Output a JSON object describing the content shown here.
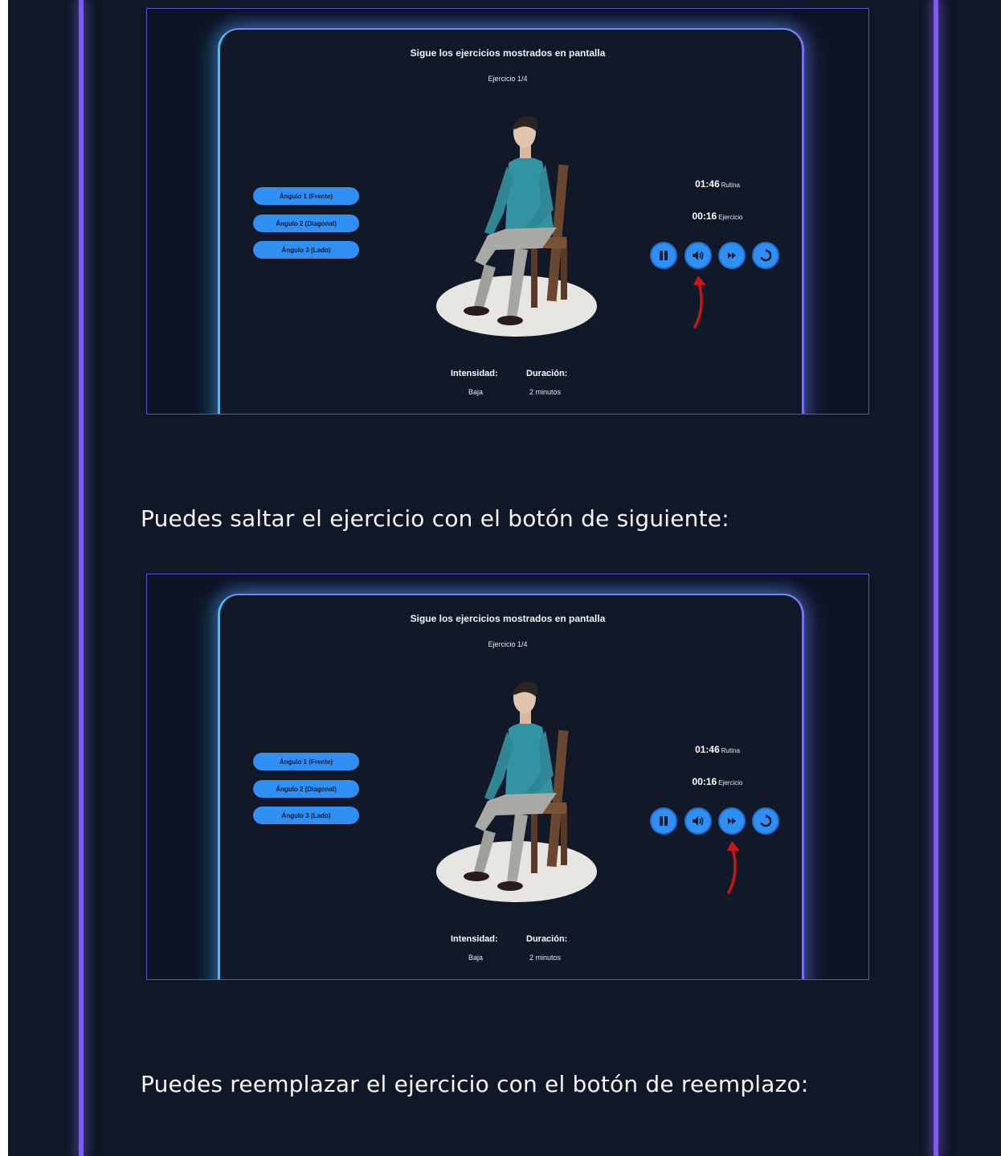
{
  "sections": [
    {
      "title": "Sigue los ejercicios mostrados en pantalla",
      "subtitle": "Ejercicio 1/4",
      "angles": [
        "Ángulo 1 (Frente)",
        "Ángulo 2 (Diagonal)",
        "Ángulo 3 (Lado)"
      ],
      "timers": {
        "routine_time": "01:46",
        "routine_label": "Rutina",
        "exercise_time": "00:16",
        "exercise_label": "Ejercicio"
      },
      "controls": [
        "pause-icon",
        "volume-icon",
        "next-icon",
        "replace-icon"
      ],
      "highlighted_control": "volume-icon",
      "stats": {
        "intensity_label": "Intensidad:",
        "intensity_value": "Baja",
        "duration_label": "Duración:",
        "duration_value": "2 minutos"
      }
    },
    {
      "title": "Sigue los ejercicios mostrados en pantalla",
      "subtitle": "Ejercicio 1/4",
      "angles": [
        "Ángulo 1 (Frente)",
        "Ángulo 2 (Diagonal)",
        "Ángulo 3 (Lado)"
      ],
      "timers": {
        "routine_time": "01:46",
        "routine_label": "Rutina",
        "exercise_time": "00:16",
        "exercise_label": "Ejercicio"
      },
      "controls": [
        "pause-icon",
        "volume-icon",
        "next-icon",
        "replace-icon"
      ],
      "highlighted_control": "next-icon",
      "stats": {
        "intensity_label": "Intensidad:",
        "intensity_value": "Baja",
        "duration_label": "Duración:",
        "duration_value": "2 minutos"
      }
    }
  ],
  "captions": [
    "Puedes saltar el ejercicio con el botón de siguiente:",
    "Puedes reemplazar el ejercicio con el botón de reemplazo:"
  ],
  "colors": {
    "page_bg": "#101726",
    "accent_blue": "#2f8ff3",
    "rail_purple": "#7a5cf0",
    "arrow_red": "#c8151b"
  }
}
